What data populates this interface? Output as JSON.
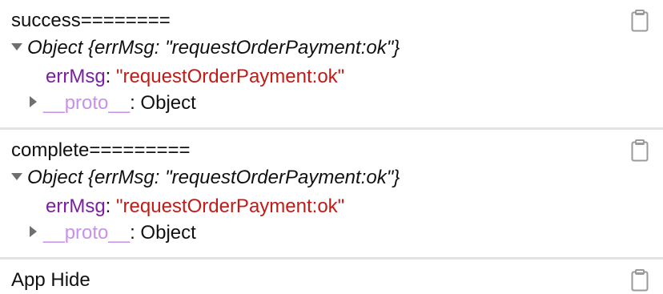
{
  "entries": [
    {
      "label": "success========",
      "object_summary_prefix": "Object {errMsg: ",
      "object_summary_value": "\"requestOrderPayment:ok\"",
      "object_summary_suffix": "}",
      "prop_key": "errMsg",
      "colon": ": ",
      "prop_value": "\"requestOrderPayment:ok\"",
      "proto_key": "__proto__",
      "proto_value": ": Object"
    },
    {
      "label": "complete=========",
      "object_summary_prefix": "Object {errMsg: ",
      "object_summary_value": "\"requestOrderPayment:ok\"",
      "object_summary_suffix": "}",
      "prop_key": "errMsg",
      "colon": ": ",
      "prop_value": "\"requestOrderPayment:ok\"",
      "proto_key": "__proto__",
      "proto_value": ": Object"
    },
    {
      "label": "App Hide"
    }
  ],
  "colors": {
    "separator": "#e3e3e3",
    "key": "#7b1fa2",
    "proto_key": "#c792ea",
    "string": "#c41a16",
    "icon": "#9a9a9a"
  },
  "icons": {
    "copy": "clipboard-icon",
    "expanded": "disclosure-triangle-down-icon",
    "collapsed": "disclosure-triangle-right-icon"
  }
}
